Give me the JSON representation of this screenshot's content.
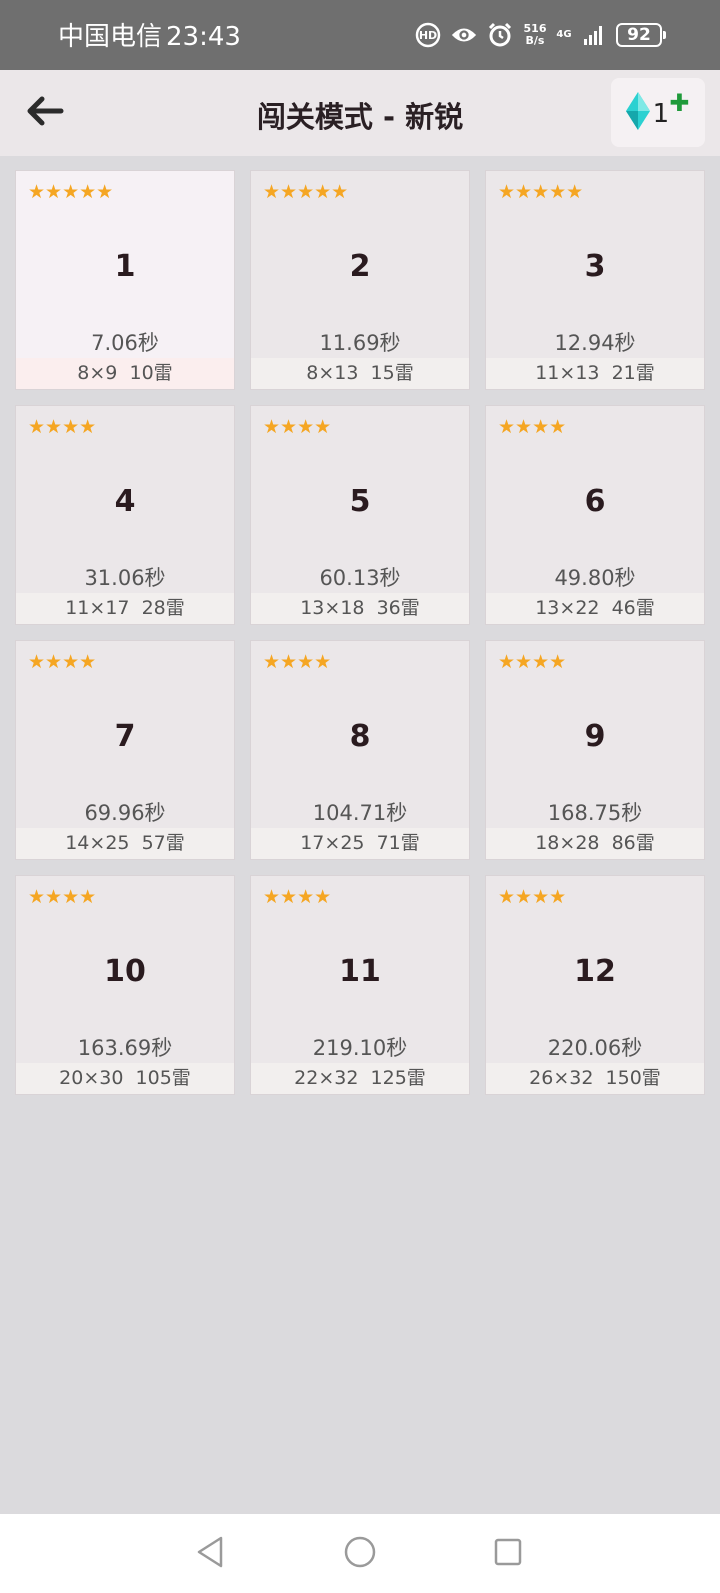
{
  "status_bar": {
    "carrier": "中国电信",
    "time": "23:43",
    "net_speed_value": "516",
    "net_speed_unit": "B/s",
    "network": "4G",
    "battery": "92"
  },
  "header": {
    "title": "闯关模式 - 新锐",
    "gem_count": "1",
    "back_icon": "back-arrow-icon",
    "gem_icon": "diamond-icon",
    "add_icon": "plus-icon"
  },
  "colors": {
    "star": "#f5a623",
    "plus": "#1f9a3a",
    "gem": "#2bd1d1"
  },
  "levels": [
    {
      "number": "1",
      "stars": "★★★★★",
      "time": "7.06秒",
      "size": "8×9",
      "mines": "10雷"
    },
    {
      "number": "2",
      "stars": "★★★★★",
      "time": "11.69秒",
      "size": "8×13",
      "mines": "15雷"
    },
    {
      "number": "3",
      "stars": "★★★★★",
      "time": "12.94秒",
      "size": "11×13",
      "mines": "21雷"
    },
    {
      "number": "4",
      "stars": "★★★★",
      "time": "31.06秒",
      "size": "11×17",
      "mines": "28雷"
    },
    {
      "number": "5",
      "stars": "★★★★",
      "time": "60.13秒",
      "size": "13×18",
      "mines": "36雷"
    },
    {
      "number": "6",
      "stars": "★★★★",
      "time": "49.80秒",
      "size": "13×22",
      "mines": "46雷"
    },
    {
      "number": "7",
      "stars": "★★★★",
      "time": "69.96秒",
      "size": "14×25",
      "mines": "57雷"
    },
    {
      "number": "8",
      "stars": "★★★★",
      "time": "104.71秒",
      "size": "17×25",
      "mines": "71雷"
    },
    {
      "number": "9",
      "stars": "★★★★",
      "time": "168.75秒",
      "size": "18×28",
      "mines": "86雷"
    },
    {
      "number": "10",
      "stars": "★★★★",
      "time": "163.69秒",
      "size": "20×30",
      "mines": "105雷"
    },
    {
      "number": "11",
      "stars": "★★★★",
      "time": "219.10秒",
      "size": "22×32",
      "mines": "125雷"
    },
    {
      "number": "12",
      "stars": "★★★★",
      "time": "220.06秒",
      "size": "26×32",
      "mines": "150雷"
    }
  ],
  "nav": {
    "back_icon": "triangle-back-icon",
    "home_icon": "circle-home-icon",
    "recents_icon": "square-recents-icon"
  }
}
